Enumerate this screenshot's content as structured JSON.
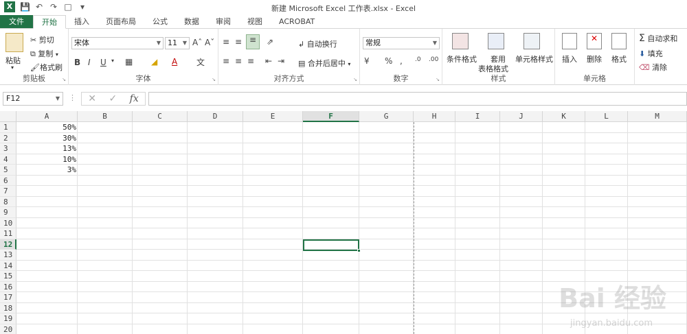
{
  "title": "新建 Microsoft Excel 工作表.xlsx - Excel",
  "tabs": [
    "文件",
    "开始",
    "插入",
    "页面布局",
    "公式",
    "数据",
    "审阅",
    "视图",
    "ACROBAT"
  ],
  "clipboard": {
    "paste": "粘贴",
    "cut": "剪切",
    "copy": "复制",
    "format_painter": "格式刷",
    "label": "剪贴板"
  },
  "font": {
    "name": "宋体",
    "size": "11",
    "label": "字体"
  },
  "alignment": {
    "wrap": "自动换行",
    "merge": "合并后居中",
    "label": "对齐方式"
  },
  "number": {
    "format": "常规",
    "label": "数字"
  },
  "styles": {
    "conditional": "条件格式",
    "table1": "套用",
    "table2": "表格格式",
    "cell_styles": "单元格样式",
    "label": "样式"
  },
  "cells": {
    "insert": "插入",
    "delete": "删除",
    "format": "格式",
    "label": "单元格"
  },
  "editing": {
    "autosum": "自动求和",
    "fill": "填充",
    "clear": "清除"
  },
  "namebox": "F12",
  "columns": [
    "A",
    "B",
    "C",
    "D",
    "E",
    "F",
    "G",
    "H",
    "I",
    "J",
    "K",
    "L",
    "M"
  ],
  "rows": [
    "1",
    "2",
    "3",
    "4",
    "5",
    "6",
    "7",
    "8",
    "9",
    "10",
    "11",
    "12",
    "13",
    "14",
    "15",
    "16",
    "17",
    "18",
    "19",
    "20"
  ],
  "column_a_values": [
    "50%",
    "30%",
    "13%",
    "10%",
    "3%"
  ],
  "watermark": {
    "brand": "Bai  经验",
    "url": "jingyan.baidu.com"
  },
  "accent": "#217346"
}
